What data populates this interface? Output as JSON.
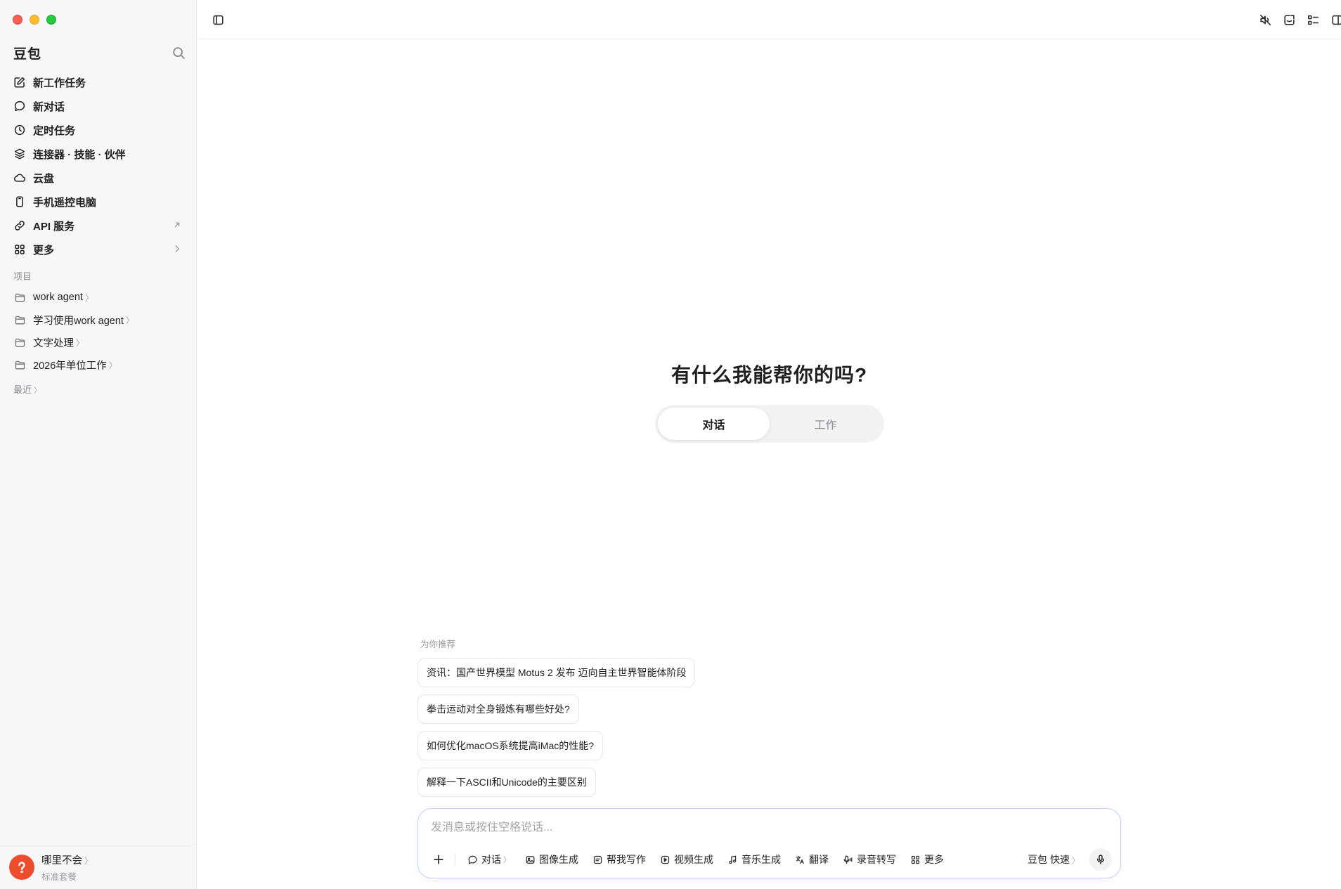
{
  "app": {
    "brand": "豆包"
  },
  "sidebar": {
    "nav": [
      {
        "label": "新工作任务",
        "icon": "edit-icon"
      },
      {
        "label": "新对话",
        "icon": "chat-bubble-icon"
      },
      {
        "label": "定时任务",
        "icon": "clock-icon"
      },
      {
        "label": "连接器 · 技能 · 伙伴",
        "icon": "layers-icon"
      },
      {
        "label": "云盘",
        "icon": "cloud-icon"
      },
      {
        "label": "手机遥控电脑",
        "icon": "phone-icon"
      },
      {
        "label": "API 服务",
        "icon": "link-icon",
        "tail": "external-arrow-icon"
      },
      {
        "label": "更多",
        "icon": "grid-icon",
        "tail": "chevron-right-icon"
      }
    ],
    "projects_label": "项目",
    "projects": [
      {
        "label": "work agent"
      },
      {
        "label": "学习使用work agent"
      },
      {
        "label": "文字处理"
      },
      {
        "label": "2026年单位工作"
      }
    ],
    "recent_label": "最近",
    "chevron": "〉",
    "user": {
      "name": "哪里不会",
      "plan": "标准套餐"
    }
  },
  "main": {
    "hero_title": "有什么我能帮你的吗?",
    "mode_tabs": [
      {
        "label": "对话",
        "active": true
      },
      {
        "label": "工作",
        "active": false
      }
    ],
    "recommend_label": "为你推荐",
    "recommendations": [
      "资讯：国产世界模型 Motus 2 发布 迈向自主世界智能体阶段",
      "拳击运动对全身锻炼有哪些好处?",
      "如何优化macOS系统提高iMac的性能?",
      "解释一下ASCII和Unicode的主要区别"
    ]
  },
  "composer": {
    "placeholder": "发消息或按住空格说话...",
    "tools": [
      {
        "label": "对话",
        "icon": "chat-bubble-icon",
        "has_chevron": true
      },
      {
        "label": "图像生成",
        "icon": "image-icon"
      },
      {
        "label": "帮我写作",
        "icon": "document-icon"
      },
      {
        "label": "视频生成",
        "icon": "video-icon"
      },
      {
        "label": "音乐生成",
        "icon": "music-note-icon"
      },
      {
        "label": "翻译",
        "icon": "translate-icon"
      },
      {
        "label": "录音转写",
        "icon": "mic-wave-icon"
      },
      {
        "label": "更多",
        "icon": "grid-icon"
      }
    ],
    "model": "豆包 快速"
  },
  "colors": {
    "accent_border": "#c9cdfb",
    "sidebar_bg": "#f7f7f8",
    "avatar": "#ee4d2d"
  }
}
